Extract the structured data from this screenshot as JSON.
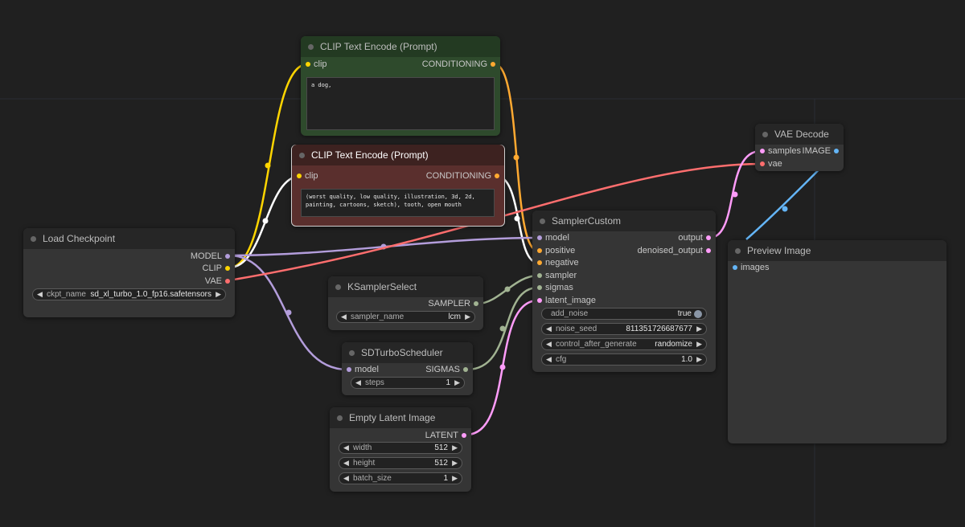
{
  "colors": {
    "clip": "#ffd500",
    "conditioning": "#ffa931",
    "model": "#b39ddb",
    "vae": "#ff6e6e",
    "latent": "#ff9cf9",
    "image": "#64b5f6",
    "sampler_sigmas": "#a1b392",
    "positive_node": "#2e4a2c",
    "negative_node": "#5a2f2d"
  },
  "nodes": {
    "load_checkpoint": {
      "title": "Load Checkpoint",
      "outputs": [
        "MODEL",
        "CLIP",
        "VAE"
      ],
      "ckpt_label": "ckpt_name",
      "ckpt_value": "sd_xl_turbo_1.0_fp16.safetensors"
    },
    "clip_positive": {
      "title": "CLIP Text Encode (Prompt)",
      "input": "clip",
      "output": "CONDITIONING",
      "text": "a dog,"
    },
    "clip_negative": {
      "title": "CLIP Text Encode (Prompt)",
      "input": "clip",
      "output": "CONDITIONING",
      "text": "(worst quality, low quality, illustration, 3d, 2d, painting, cartoons, sketch), tooth, open mouth"
    },
    "ksampler_select": {
      "title": "KSamplerSelect",
      "output": "SAMPLER",
      "sampler_label": "sampler_name",
      "sampler_value": "lcm"
    },
    "sd_turbo_scheduler": {
      "title": "SDTurboScheduler",
      "input": "model",
      "output": "SIGMAS",
      "steps_label": "steps",
      "steps_value": "1"
    },
    "empty_latent": {
      "title": "Empty Latent Image",
      "output": "LATENT",
      "width_label": "width",
      "width_value": "512",
      "height_label": "height",
      "height_value": "512",
      "batch_label": "batch_size",
      "batch_value": "1"
    },
    "sampler_custom": {
      "title": "SamplerCustom",
      "inputs": [
        "model",
        "positive",
        "negative",
        "sampler",
        "sigmas",
        "latent_image"
      ],
      "outputs": [
        "output",
        "denoised_output"
      ],
      "add_noise_label": "add_noise",
      "add_noise_value": "true",
      "seed_label": "noise_seed",
      "seed_value": "811351726687677",
      "control_label": "control_after_generate",
      "control_value": "randomize",
      "cfg_label": "cfg",
      "cfg_value": "1.0"
    },
    "vae_decode": {
      "title": "VAE Decode",
      "inputs": [
        "samples",
        "vae"
      ],
      "output": "IMAGE"
    },
    "preview_image": {
      "title": "Preview Image",
      "input": "images"
    }
  },
  "icons": {
    "left": "◀",
    "right": "▶"
  }
}
